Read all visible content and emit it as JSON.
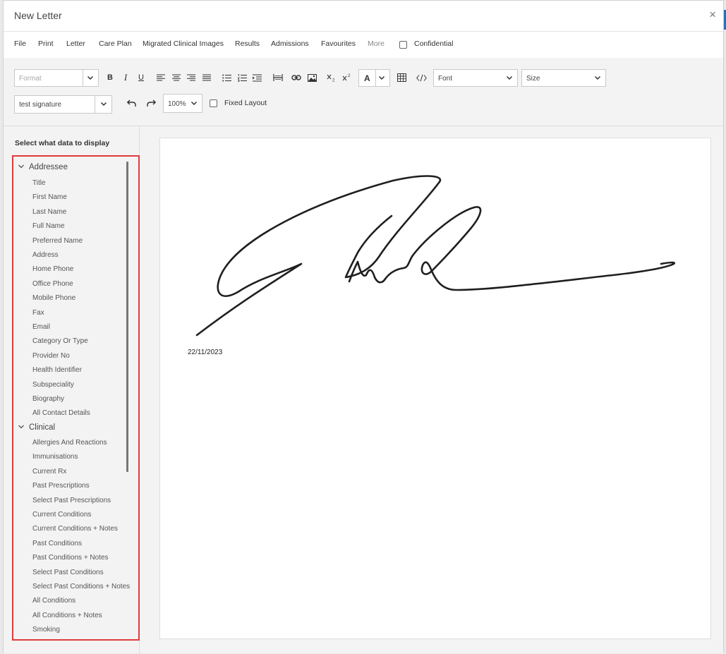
{
  "dialog": {
    "title": "New Letter",
    "close_glyph": "×"
  },
  "menu": {
    "items": [
      "File",
      "Print",
      "Letter",
      "Care Plan",
      "Migrated Clinical Images",
      "Results",
      "Admissions",
      "Favourites",
      "More"
    ],
    "confidential_label": "Confidential"
  },
  "toolbar": {
    "format_placeholder": "Format",
    "bold": "B",
    "italic": "I",
    "underline": "U",
    "text_color": "A",
    "font_placeholder": "Font",
    "size_placeholder": "Size",
    "signature_value": "test signature",
    "zoom_value": "100%",
    "fixed_layout_label": "Fixed Layout"
  },
  "sidebar": {
    "heading": "Select what data to display",
    "groups": [
      {
        "label": "Addressee",
        "expanded": true
      },
      {
        "label": "Clinical",
        "expanded": true
      }
    ],
    "addressee_fields": [
      "Title",
      "First Name",
      "Last Name",
      "Full Name",
      "Preferred Name",
      "Address",
      "Home Phone",
      "Office Phone",
      "Mobile Phone",
      "Fax",
      "Email",
      "Category Or Type",
      "Provider No",
      "Health Identifier",
      "Subspeciality",
      "Biography",
      "All Contact Details"
    ],
    "clinical_fields": [
      "Allergies And Reactions",
      "Immunisations",
      "Current Rx",
      "Past Prescriptions",
      "Select Past Prescriptions",
      "Current Conditions",
      "Current Conditions + Notes",
      "Past Conditions",
      "Past Conditions + Notes",
      "Select Past Conditions",
      "Select Past Conditions + Notes",
      "All Conditions",
      "All Conditions + Notes",
      "Smoking"
    ]
  },
  "letter": {
    "date": "22/11/2023"
  },
  "colors": {
    "highlight_border": "#e03c3c",
    "panel_bg": "#f3f3f3",
    "accent": "#1e73be"
  },
  "icons": [
    "close-icon",
    "chevron-down-icon",
    "undo-icon",
    "redo-icon",
    "link-icon",
    "image-icon",
    "table-icon",
    "source-code-icon",
    "bullet-list-icon",
    "numbered-list-icon",
    "indent-icon",
    "horizontal-rule-icon"
  ]
}
